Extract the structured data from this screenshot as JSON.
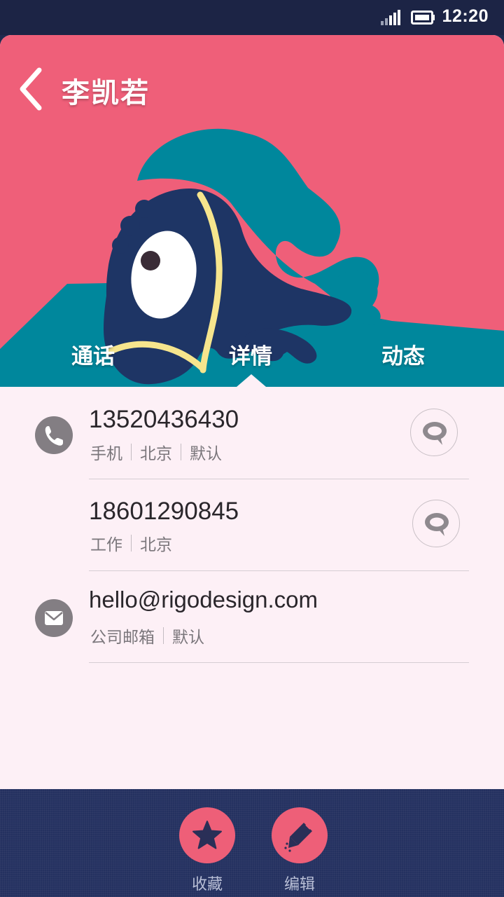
{
  "status_bar": {
    "time": "12:20",
    "icons": [
      "signal-icon",
      "battery-icon"
    ]
  },
  "header": {
    "back_icon": "chevron-left-icon",
    "contact_name": "李凯若"
  },
  "tabs": [
    {
      "label": "通话",
      "selected": false
    },
    {
      "label": "详情",
      "selected": true
    },
    {
      "label": "动态",
      "selected": false
    }
  ],
  "details": {
    "phones": [
      {
        "number": "13520436430",
        "tags": [
          "手机",
          "北京",
          "默认"
        ],
        "type_icon": "phone-icon",
        "action_icon": "message-icon"
      },
      {
        "number": "18601290845",
        "tags": [
          "工作",
          "北京"
        ],
        "action_icon": "message-icon"
      }
    ],
    "email": {
      "address": "hello@rigodesign.com",
      "tags": [
        "公司邮箱",
        "默认"
      ],
      "type_icon": "envelope-icon"
    }
  },
  "actions": [
    {
      "label": "收藏",
      "icon": "star-icon"
    },
    {
      "label": "编辑",
      "icon": "pencil-icon"
    }
  ],
  "colors": {
    "hero_background": "#ef5f79",
    "hero_ground": "#00879c",
    "bird_body": "#1e3565",
    "bird_crest": "#00879c",
    "action_button": "#ee5f78",
    "bottom_bar": "#243160",
    "card_background": "#fdf0f6"
  }
}
